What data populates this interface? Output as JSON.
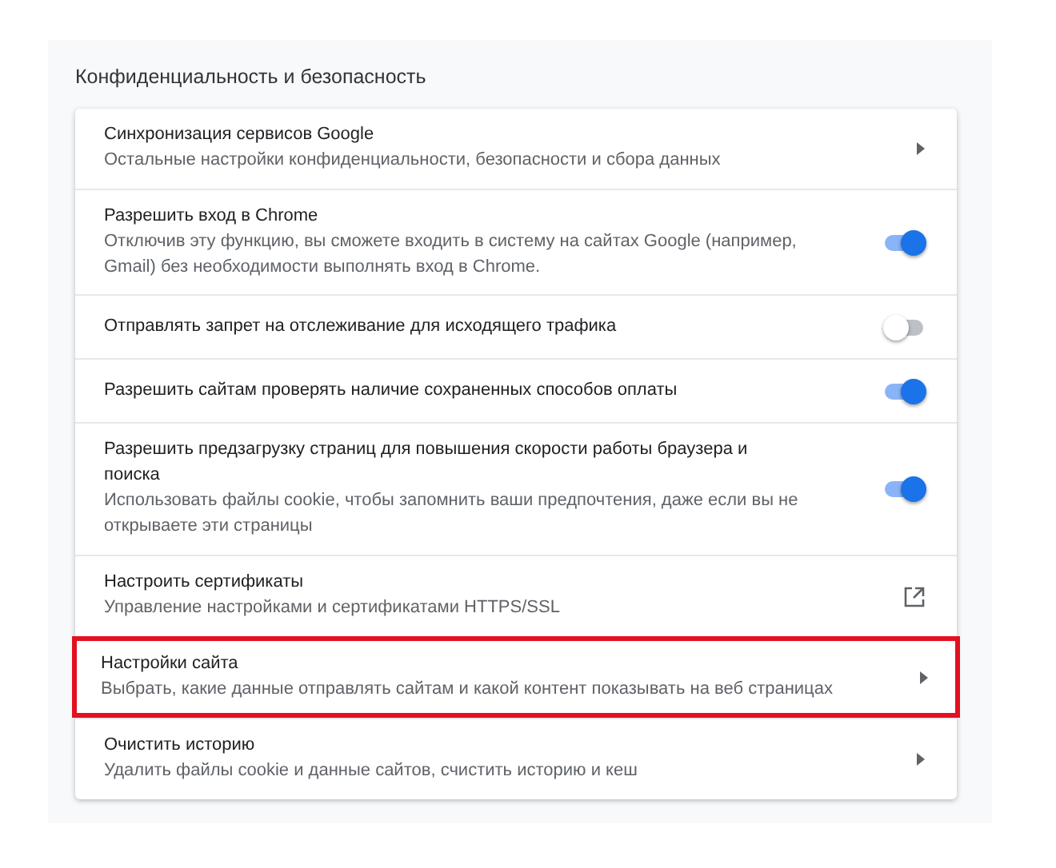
{
  "section": {
    "title": "Конфиденциальность и безопасность"
  },
  "rows": [
    {
      "kind": "arrow",
      "title": "Синхронизация сервисов Google",
      "subtitle": "Остальные настройки конфиденциальности, безопасности и сбора данных",
      "highlighted": false
    },
    {
      "kind": "toggle",
      "title": "Разрешить вход в Chrome",
      "subtitle": "Отключив эту функцию, вы сможете входить в систему на сайтах Google (например, Gmail) без необходимости выполнять вход в Chrome.",
      "on": true,
      "highlighted": false
    },
    {
      "kind": "toggle",
      "title": "Отправлять запрет на отслеживание для исходящего трафика",
      "on": false,
      "highlighted": false
    },
    {
      "kind": "toggle",
      "title": "Разрешить сайтам проверять наличие сохраненных способов оплаты",
      "on": true,
      "highlighted": false
    },
    {
      "kind": "toggle",
      "title": "Разрешить предзагрузку страниц для повышения скорости работы браузера и поиска",
      "subtitle": "Использовать файлы cookie, чтобы запомнить ваши предпочтения, даже если вы не открываете эти страницы",
      "on": true,
      "highlighted": false
    },
    {
      "kind": "external",
      "title": "Настроить сертификаты",
      "subtitle": "Управление настройками и сертификатами HTTPS/SSL",
      "highlighted": false
    },
    {
      "kind": "arrow",
      "title": "Настройки сайта",
      "subtitle": "Выбрать, какие данные отправлять сайтам и какой контент показывать на веб страницах",
      "highlighted": true
    },
    {
      "kind": "arrow",
      "title": "Очистить историю",
      "subtitle": "Удалить файлы cookie и данные сайтов, счистить историю и кеш",
      "highlighted": false
    }
  ]
}
